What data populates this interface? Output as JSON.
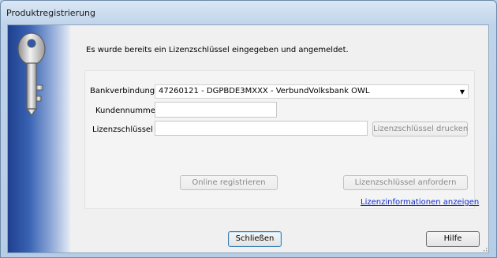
{
  "window": {
    "title": "Produktregistrierung"
  },
  "intro_text": "Es wurde bereits ein Lizenzschlüssel eingegeben und angemeldet.",
  "form": {
    "bank_label": "Bankverbindung",
    "bank_value": "47260121 - DGPBDE3MXXX - VerbundVolksbank OWL",
    "customer_label": "Kundennummer",
    "customer_value": "",
    "license_label": "Lizenzschlüssel",
    "license_value": "",
    "print_license_button": "Lizenzschlüssel drucken"
  },
  "actions": {
    "register_online_button": "Online registrieren",
    "request_license_button": "Lizenzschlüssel anfordern",
    "license_info_link": "Lizenzinformationen anzeigen"
  },
  "footer": {
    "close_button": "Schließen",
    "help_button": "Hilfe"
  },
  "icons": {
    "banner": "key-icon",
    "dropdown": "chevron-down-icon"
  },
  "colors": {
    "banner_dark": "#1f3f8e",
    "link": "#0a28c8",
    "default_button_border": "#3c7fb1"
  }
}
